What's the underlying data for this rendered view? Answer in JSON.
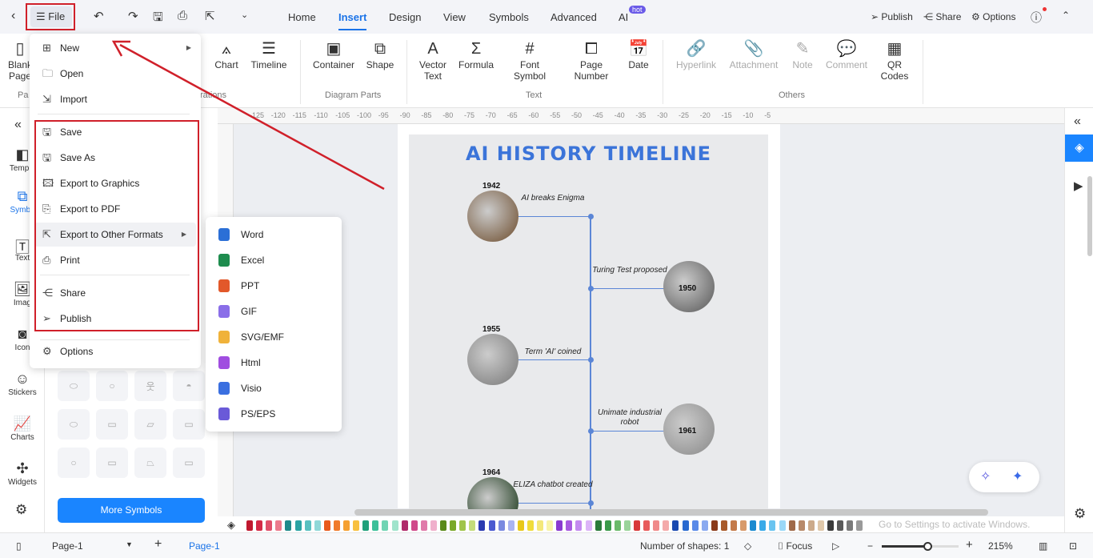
{
  "toolbar": {
    "file": "File",
    "tabs": [
      "Home",
      "Insert",
      "Design",
      "View",
      "Symbols",
      "Advanced",
      "AI"
    ],
    "ai_badge": "hot",
    "publish": "Publish",
    "share": "Share",
    "options": "Options"
  },
  "ribbon": {
    "buttons": [
      {
        "label": "Blank Page",
        "icon": "page"
      },
      {
        "label": "Chart",
        "icon": "chart"
      },
      {
        "label": "Timeline",
        "icon": "timeline"
      },
      {
        "label": "Container",
        "icon": "container"
      },
      {
        "label": "Shape",
        "icon": "shape"
      },
      {
        "label": "Vector Text",
        "icon": "vector-text"
      },
      {
        "label": "Formula",
        "icon": "sigma"
      },
      {
        "label": "Font Symbol",
        "icon": "hash"
      },
      {
        "label": "Page Number",
        "icon": "page-number"
      },
      {
        "label": "Date",
        "icon": "calendar"
      },
      {
        "label": "Hyperlink",
        "icon": "link"
      },
      {
        "label": "Attachment",
        "icon": "paperclip"
      },
      {
        "label": "Note",
        "icon": "pen"
      },
      {
        "label": "Comment",
        "icon": "comment"
      },
      {
        "label": "QR Codes",
        "icon": "qr"
      }
    ],
    "groups": [
      "Pa",
      "rations",
      "Diagram Parts",
      "Text",
      "Others"
    ]
  },
  "ruler": [
    "-125",
    "-120",
    "-115",
    "-110",
    "-105",
    "-100",
    "-95",
    "-90",
    "-85",
    "-80",
    "-75",
    "-70",
    "-65",
    "-60",
    "-55",
    "-50",
    "-45",
    "-40",
    "-35",
    "-30",
    "-25",
    "-20",
    "-15",
    "-10",
    "-5"
  ],
  "sidebar": {
    "items": [
      "Templa",
      "Symbo",
      "Text",
      "Imag",
      "Icon",
      "Stickers",
      "Charts",
      "Widgets"
    ],
    "more_symbols": "More Symbols"
  },
  "file_menu": {
    "items": [
      {
        "label": "New",
        "icon": "plus-square",
        "submenu": true
      },
      {
        "label": "Open",
        "icon": "folder"
      },
      {
        "label": "Import",
        "icon": "import"
      },
      {
        "label": "Save",
        "icon": "save"
      },
      {
        "label": "Save As",
        "icon": "save-as"
      },
      {
        "label": "Export to Graphics",
        "icon": "image"
      },
      {
        "label": "Export to PDF",
        "icon": "pdf"
      },
      {
        "label": "Export to Other Formats",
        "icon": "export",
        "submenu": true
      },
      {
        "label": "Print",
        "icon": "printer"
      },
      {
        "label": "Share",
        "icon": "share"
      },
      {
        "label": "Publish",
        "icon": "send"
      },
      {
        "label": "Options",
        "icon": "gear"
      }
    ]
  },
  "export_submenu": [
    {
      "label": "Word",
      "color": "#2b6fd6"
    },
    {
      "label": "Excel",
      "color": "#1e8c4e"
    },
    {
      "label": "PPT",
      "color": "#e2582a"
    },
    {
      "label": "GIF",
      "color": "#8a6ee8"
    },
    {
      "label": "SVG/EMF",
      "color": "#f0b23a"
    },
    {
      "label": "Html",
      "color": "#a04de0"
    },
    {
      "label": "Visio",
      "color": "#3a6fe0"
    },
    {
      "label": "PS/EPS",
      "color": "#6a5ad8"
    }
  ],
  "timeline": {
    "title": "AI HISTORY TIMELINE",
    "events": [
      {
        "year": "1942",
        "caption": "AI breaks Enigma"
      },
      {
        "year": "1950",
        "caption": "Turing Test proposed"
      },
      {
        "year": "1955",
        "caption": "Term 'AI' coined"
      },
      {
        "year": "1961",
        "caption": "Unimate industrial robot"
      },
      {
        "year": "1964",
        "caption": "ELIZA chatbot created"
      }
    ]
  },
  "palette": [
    "#c0182f",
    "#d42a47",
    "#e0506a",
    "#ec7a8c",
    "#1f8a8a",
    "#2aa3a3",
    "#58c0c0",
    "#8fd8d8",
    "#e85a1c",
    "#f07a2a",
    "#f5a030",
    "#f8c040",
    "#1fa07a",
    "#3cc09a",
    "#70d4b4",
    "#a0e4cc",
    "#b02a6a",
    "#d04a8a",
    "#e07aaa",
    "#f0b0cc",
    "#5a8a1a",
    "#7aa82a",
    "#a0c44a",
    "#c4dc7a",
    "#2a3ab0",
    "#4a5ad0",
    "#7a8ae0",
    "#aab4f0",
    "#e8c81a",
    "#f0dc3a",
    "#f4e87a",
    "#f8f4a8",
    "#8a3ad0",
    "#a85ae0",
    "#c48af0",
    "#dcb4f8",
    "#2a7a3a",
    "#3a9a4a",
    "#6aba6a",
    "#9ad49a",
    "#d83a3a",
    "#e85a5a",
    "#f08a8a",
    "#f4aaaa",
    "#1a4ab0",
    "#2a6ad0",
    "#5a8ae8",
    "#8aaaf0",
    "#8a3a1a",
    "#a85a2a",
    "#c47a4a",
    "#d89a6a",
    "#1a8ad0",
    "#3aaae8",
    "#6ac4f0",
    "#9ad8f8",
    "#a06a4a",
    "#b88a6a",
    "#ccaa8a",
    "#e0c8aa",
    "#3a3a3a",
    "#5a5a5a",
    "#7a7a7a",
    "#9a9a9a"
  ],
  "status": {
    "page_select": "Page-1",
    "page_tab": "Page-1",
    "shapes": "Number of shapes: 1",
    "focus": "Focus",
    "zoom": "215%",
    "zoom_level": 0.6
  },
  "watermark": "Go to Settings to activate Windows."
}
